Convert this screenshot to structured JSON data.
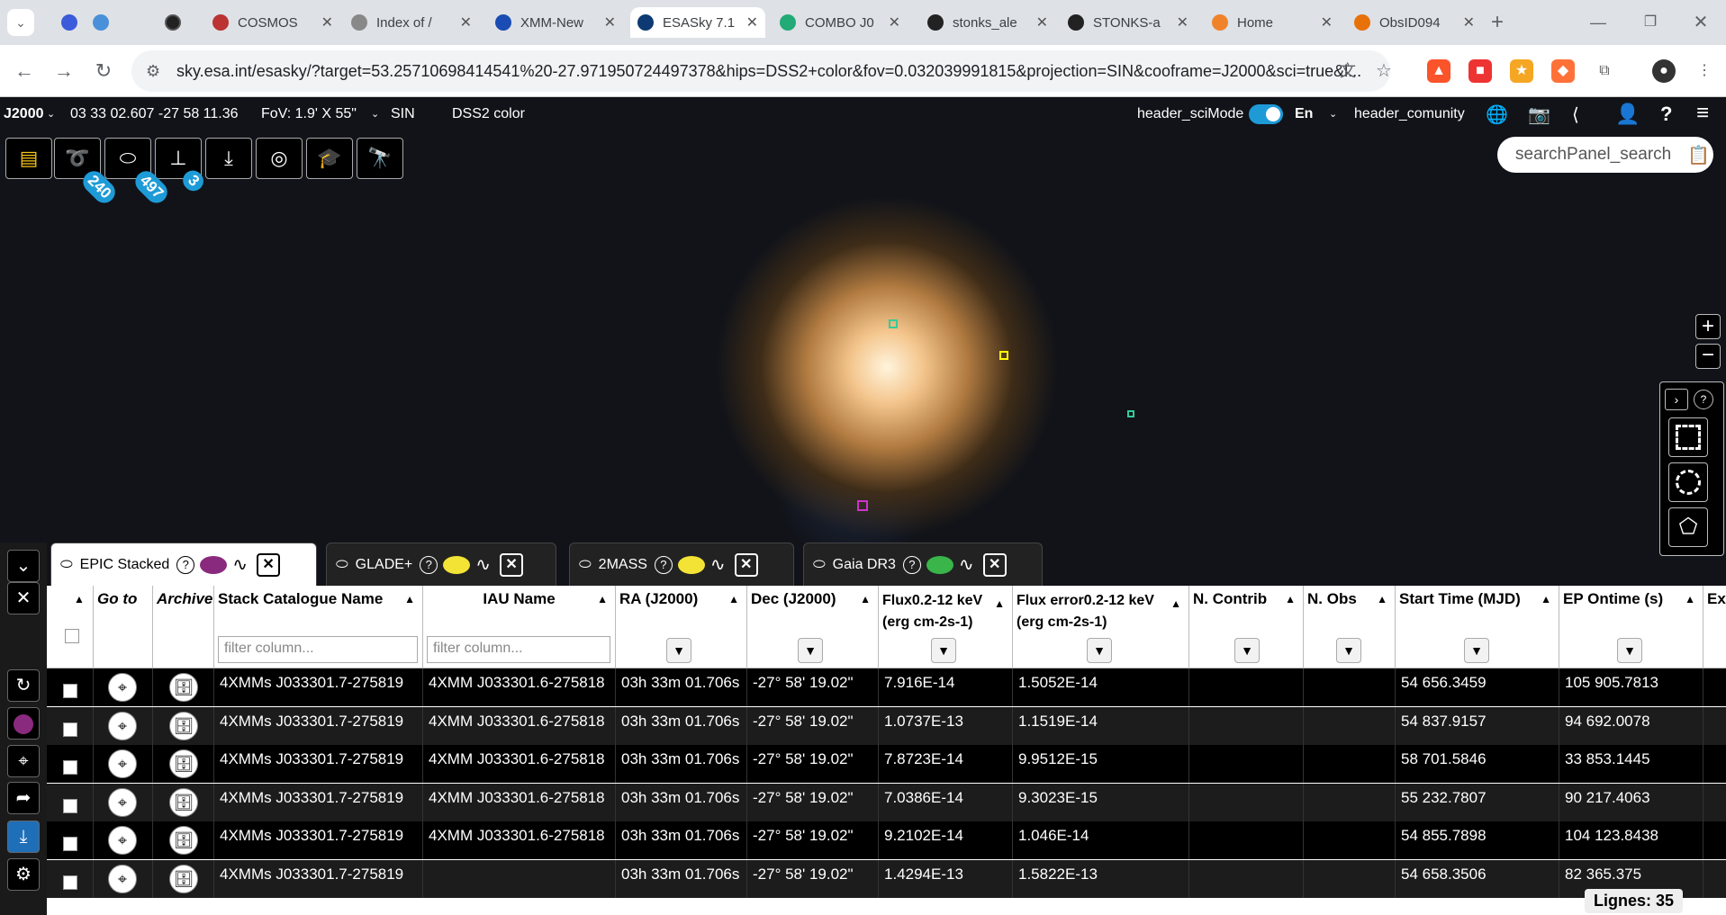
{
  "browser": {
    "tabs": [
      {
        "title": "COSMOS",
        "fav": "#b33"
      },
      {
        "title": "Index of /",
        "fav": "#888"
      },
      {
        "title": "XMM-New",
        "fav": "#1a4cb3"
      },
      {
        "title": "ESASky 7.1",
        "fav": "#0d3a73"
      },
      {
        "title": "COMBO J0",
        "fav": "#2a7"
      },
      {
        "title": "stonks_ale",
        "fav": "#222"
      },
      {
        "title": "STONKS-a",
        "fav": "#222"
      },
      {
        "title": "Home",
        "fav": "#f0832a"
      },
      {
        "title": "ObsID094",
        "fav": "#e8710a"
      }
    ],
    "url": "sky.esa.int/esasky/?target=53.25710698414541%20-27.971950724497378&hips=DSS2+color&fov=0.032039991815&projection=SIN&cooframe=J2000&sci=true&l..."
  },
  "infobar": {
    "frame": "J2000",
    "coords": "03 33 02.607 -27 58 11.36",
    "fov": "FoV: 1.9' X 55\"",
    "projection": "SIN",
    "survey": "DSS2 color",
    "scimode_label": "header_sciMode",
    "language": "En",
    "community_label": "header_comunity"
  },
  "toolbar": {
    "badges": [
      "240",
      "497",
      "3"
    ]
  },
  "search": {
    "placeholder": "searchPanel_search"
  },
  "panel": {
    "tabs": [
      {
        "label": "EPIC Stacked",
        "color": "#8a2a7e"
      },
      {
        "label": "GLADE+",
        "color": "#f2e335"
      },
      {
        "label": "2MASS",
        "color": "#f2e335"
      },
      {
        "label": "Gaia DR3",
        "color": "#39b54a"
      }
    ],
    "columns": {
      "goto": "Go to",
      "archive": "Archive",
      "stack": "Stack Catalogue Name",
      "iau": "IAU Name",
      "ra": "RA (J2000)",
      "dec": "Dec (J2000)",
      "flux": "Flux0.2-12 keV (erg cm-2s-1)",
      "fluxerr": "Flux error0.2-12 keV (erg cm-2s-1)",
      "ncontrib": "N. Contrib",
      "nobs": "N. Obs",
      "start": "Start Time (MJD)",
      "ep": "EP Ontime (s)",
      "more": "Ex"
    },
    "filter_placeholder": "filter column...",
    "rows": [
      {
        "stack": "4XMMs J033301.7-275819",
        "iau": "4XMM J033301.6-275818",
        "ra": "03h 33m 01.706s",
        "dec": "-27° 58' 19.02\"",
        "flux": "7.916E-14",
        "fluxerr": "1.5052E-14",
        "start": "54 656.3459",
        "ep": "105 905.7813"
      },
      {
        "stack": "4XMMs J033301.7-275819",
        "iau": "4XMM J033301.6-275818",
        "ra": "03h 33m 01.706s",
        "dec": "-27° 58' 19.02\"",
        "flux": "1.0737E-13",
        "fluxerr": "1.1519E-14",
        "start": "54 837.9157",
        "ep": "94 692.0078"
      },
      {
        "stack": "4XMMs J033301.7-275819",
        "iau": "4XMM J033301.6-275818",
        "ra": "03h 33m 01.706s",
        "dec": "-27° 58' 19.02\"",
        "flux": "7.8723E-14",
        "fluxerr": "9.9512E-15",
        "start": "58 701.5846",
        "ep": "33 853.1445"
      },
      {
        "stack": "4XMMs J033301.7-275819",
        "iau": "4XMM J033301.6-275818",
        "ra": "03h 33m 01.706s",
        "dec": "-27° 58' 19.02\"",
        "flux": "7.0386E-14",
        "fluxerr": "9.3023E-15",
        "start": "55 232.7807",
        "ep": "90 217.4063"
      },
      {
        "stack": "4XMMs J033301.7-275819",
        "iau": "4XMM J033301.6-275818",
        "ra": "03h 33m 01.706s",
        "dec": "-27° 58' 19.02\"",
        "flux": "9.2102E-14",
        "fluxerr": "1.046E-14",
        "start": "54 855.7898",
        "ep": "104 123.8438"
      },
      {
        "stack": "4XMMs J033301.7-275819",
        "iau": "",
        "ra": "03h 33m 01.706s",
        "dec": "-27° 58' 19.02\"",
        "flux": "1.4294E-13",
        "fluxerr": "1.5822E-13",
        "start": "54 658.3506",
        "ep": "82 365.375"
      }
    ],
    "lines_count": "Lignes: 35"
  }
}
